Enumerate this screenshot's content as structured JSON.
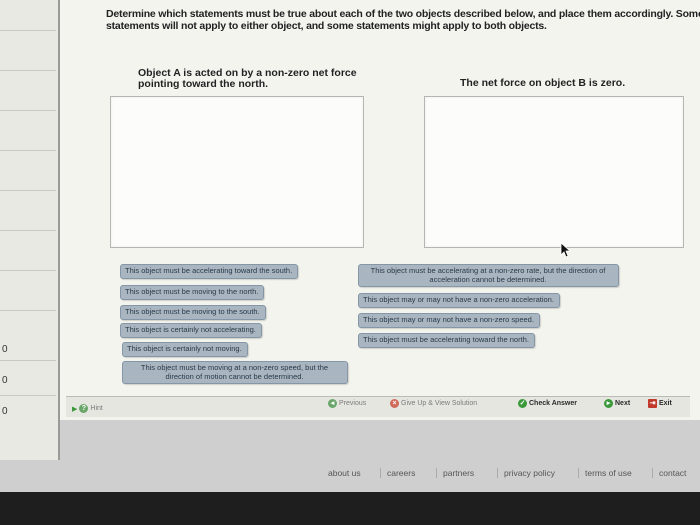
{
  "instructions": "Determine which statements must be true about each of the two objects described below, and place them accordingly. Some statements will not apply to either object, and some statements might apply to both objects.",
  "object_a": {
    "heading": "Object A is acted on by a non-zero net force pointing toward the north."
  },
  "object_b": {
    "heading": "The net force on object B is zero."
  },
  "chips": [
    "This object must be accelerating toward the south.",
    "This object must be moving to the north.",
    "This object must be moving to the south.",
    "This object is certainly not accelerating.",
    "This object is certainly not moving.",
    "This object must be moving at a non-zero speed, but the direction of motion cannot be determined.",
    "This object must be accelerating at a non-zero rate, but the direction of acceleration cannot be determined.",
    "This object may or may not have a non-zero acceleration.",
    "This object may or may not have a non-zero speed.",
    "This object must be accelerating toward the north."
  ],
  "toolbar": {
    "hint": "Hint",
    "previous": "Previous",
    "give_up": "Give Up & View Solution",
    "check": "Check Answer",
    "next": "Next",
    "exit": "Exit"
  },
  "footer": [
    "about us",
    "careers",
    "partners",
    "privacy policy",
    "terms of use",
    "contact"
  ],
  "strip_digits": [
    "0",
    "0",
    "0"
  ],
  "colors": {
    "chip": "#a9b6c1",
    "check": "#3a9a3a",
    "exit": "#c0392b"
  }
}
